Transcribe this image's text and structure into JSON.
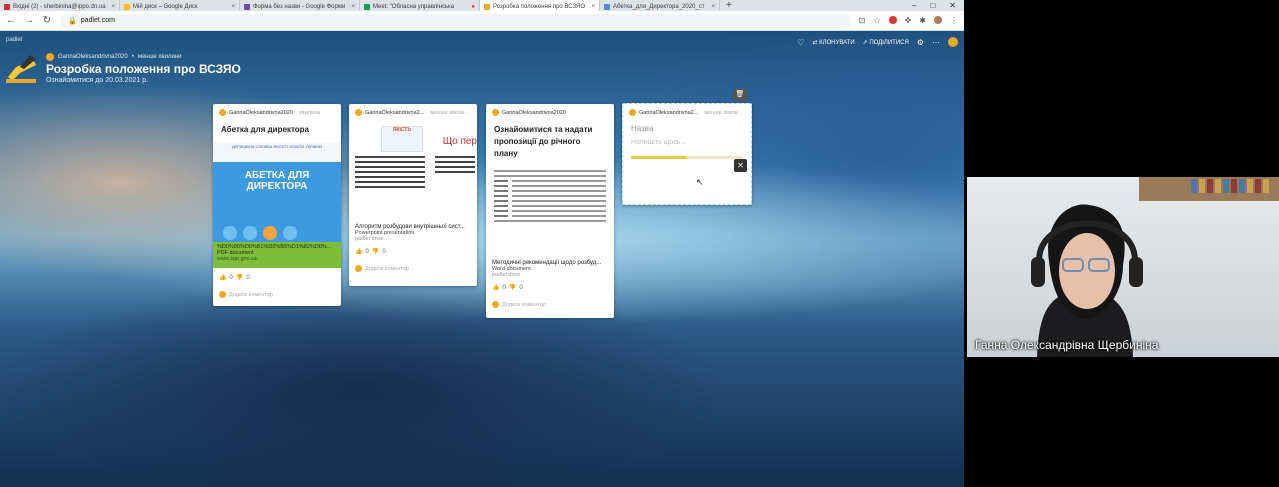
{
  "browser": {
    "tabs": [
      {
        "label": "Вхідні (2) - sherbinina@ippo.dn.ua",
        "active": false
      },
      {
        "label": "Мій диск – Google Диск",
        "active": false
      },
      {
        "label": "Форма без назви - Google Форми",
        "active": false
      },
      {
        "label": "Meet: \"Обласна управлінська",
        "active": false
      },
      {
        "label": "Розробка положення про ВСЗЯО",
        "active": true
      },
      {
        "label": "Абетка_для_Директора_2020_ст",
        "active": false
      }
    ],
    "new_tab": "+",
    "url": "padlet.com",
    "window_controls": [
      "–",
      "□",
      "✕"
    ]
  },
  "padlet": {
    "brand": "padlet",
    "actions": {
      "clone": "КЛОНУВАТИ",
      "share": "ПОДІЛИТИСЯ"
    },
    "author": "GannaOleksandrivna2020",
    "author_time": "менше хвилини",
    "title": "Розробка положення про ВСЗЯО",
    "subtitle": "Ознайомитися до 20.03.2021 р.",
    "cards": [
      {
        "author": "GannaOleksandrivna2020",
        "time": "хвилина",
        "title": "Абетка для директора",
        "preview_top": "ДЕРЖАВНА СЛУЖБА ЯКОСТІ ОСВІТИ УКРАЇНИ",
        "preview_big": "АБЕТКА ДЛЯ ДИРЕКТОРА",
        "file_name": "%D0%90%D0%B1%D0%B5%D1%82%D0%...",
        "file_type": "PDF document",
        "file_source": "www.sqe.gov.ua",
        "likes": "0",
        "dislikes": "0",
        "comment": "Додати коментар"
      },
      {
        "author": "GannaOleksandrivna2...",
        "time": "менше хвили...",
        "preview_red": "Що пер",
        "file_name": "Алгоритм розбудови внутрішньої сист...",
        "file_type": "Powerpoint presentation",
        "file_source": "padlet drive",
        "likes": "0",
        "dislikes": "0",
        "comment": "Додати коментар"
      },
      {
        "author": "GannaOleksandrivna2020",
        "title": "Ознайомитися та надати пропозиції до річного плану",
        "file_name": "Методичні рекомендації щодо розбуд...",
        "file_type": "Word document",
        "file_source": "padlet drive",
        "likes": "0",
        "dislikes": "0",
        "comment": "Додати коментар"
      },
      {
        "author": "GannaOleksandrivna2...",
        "time": "менше хвили...",
        "title_placeholder": "Назва",
        "body_placeholder": "Напишіть щось...",
        "upload_progress": 0.5
      }
    ]
  },
  "webcam": {
    "name": "Ганна Олександрівна Щербиніна"
  },
  "colors": {
    "accent_avatar": "#f0a81e",
    "green_bar": "#7ebd3a",
    "abetka_blue": "#3c9be0"
  }
}
